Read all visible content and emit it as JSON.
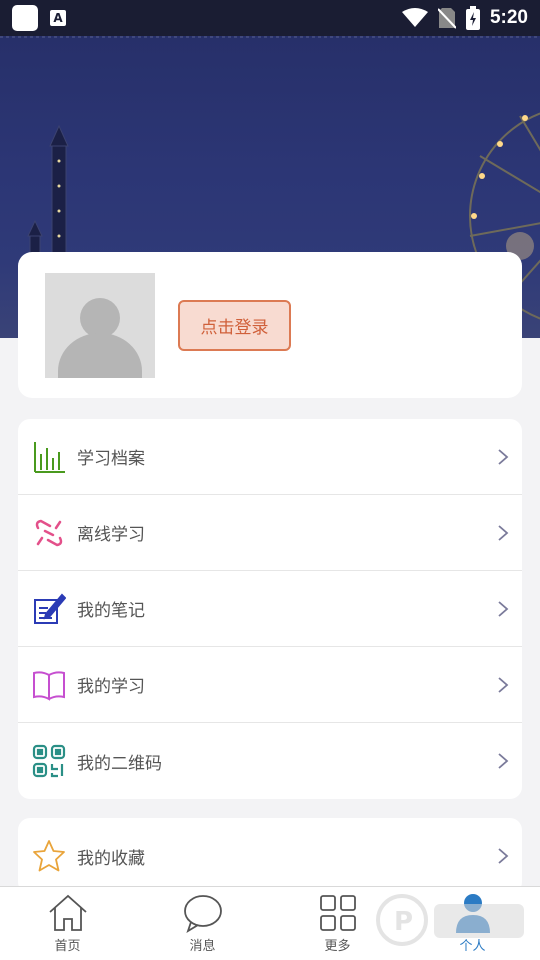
{
  "status_bar": {
    "time": "5:20"
  },
  "profile": {
    "login_label": "点击登录"
  },
  "menu_group1": [
    {
      "label": "学习档案",
      "icon": "bar-chart-icon",
      "color": "#4a9a1e"
    },
    {
      "label": "离线学习",
      "icon": "offline-icon",
      "color": "#e3508a"
    },
    {
      "label": "我的笔记",
      "icon": "note-icon",
      "color": "#2b3bb5"
    },
    {
      "label": "我的学习",
      "icon": "book-icon",
      "color": "#c64fd0"
    },
    {
      "label": "我的二维码",
      "icon": "qr-code-icon",
      "color": "#2a8f86"
    }
  ],
  "menu_group2": [
    {
      "label": "我的收藏",
      "icon": "star-icon",
      "color": "#e9a43a"
    }
  ],
  "bottom_nav": [
    {
      "label": "首页",
      "icon": "home-icon"
    },
    {
      "label": "消息",
      "icon": "message-icon"
    },
    {
      "label": "更多",
      "icon": "grid-icon"
    },
    {
      "label": "个人",
      "icon": "person-icon",
      "active": true
    }
  ],
  "colors": {
    "accent": "#2b7bc4",
    "login_border": "#dc7a53",
    "header": "#2c3675"
  }
}
